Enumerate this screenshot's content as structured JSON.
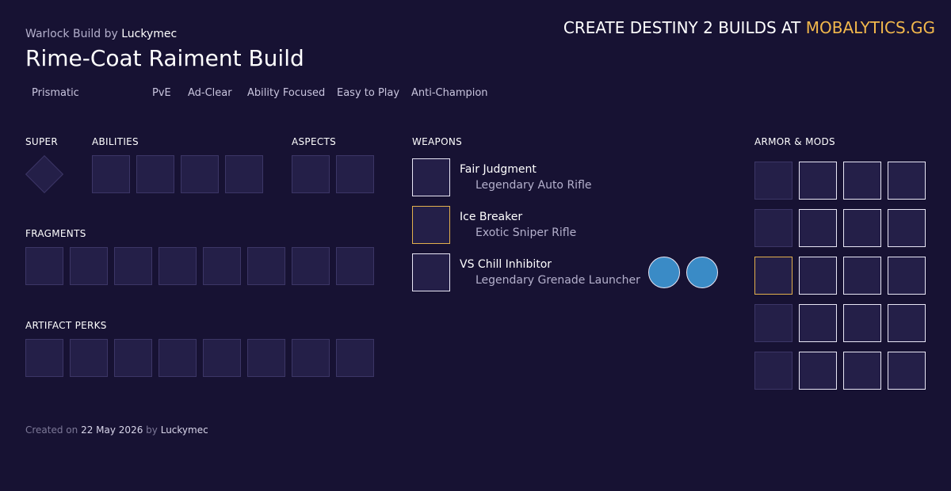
{
  "header": {
    "subtitle_prefix": "Warlock Build by",
    "author": "Luckymec",
    "title": "Rime-Coat Raiment Build",
    "promo_text": "CREATE DESTINY 2 BUILDS AT",
    "promo_brand": "MOBALYTICS.GG"
  },
  "tags": [
    "Prismatic",
    "PvE",
    "Ad-Clear",
    "Ability Focused",
    "Easy to Play",
    "Anti-Champion"
  ],
  "sections": {
    "super": "SUPER",
    "abilities": "ABILITIES",
    "aspects": "ASPECTS",
    "fragments": "FRAGMENTS",
    "artifact_perks": "ARTIFACT PERKS",
    "weapons": "WEAPONS",
    "armor_mods": "ARMOR & MODS"
  },
  "weapons": [
    {
      "name": "Fair Judgment",
      "type": "Legendary Auto Rifle",
      "rarity": "legendary"
    },
    {
      "name": "Ice Breaker",
      "type": "Exotic Sniper Rifle",
      "rarity": "exotic"
    },
    {
      "name": "VS Chill Inhibitor",
      "type": "Legendary Grenade Launcher",
      "rarity": "legendary"
    }
  ],
  "footer": {
    "prefix": "Created on",
    "date": "22 May 2026",
    "by": "by",
    "author": "Luckymec"
  },
  "colors": {
    "background": "#171233",
    "accent_gold": "#f2b84c",
    "perk_blue": "#3a8bc6"
  }
}
